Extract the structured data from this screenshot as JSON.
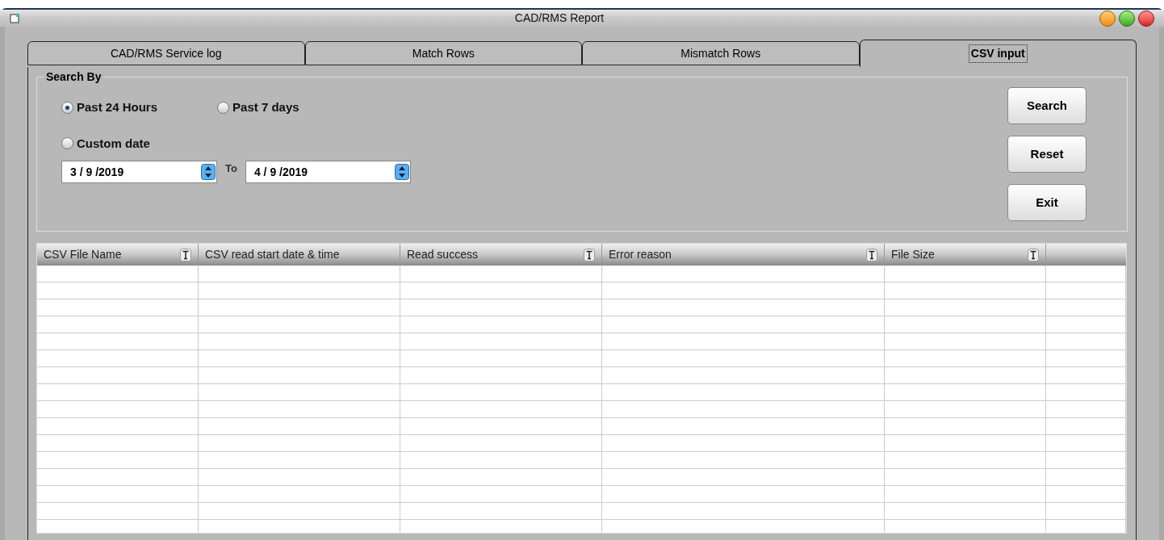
{
  "window": {
    "title": "CAD/RMS Report"
  },
  "tabs": [
    {
      "label": "CAD/RMS Service log",
      "selected": false
    },
    {
      "label": "Match Rows",
      "selected": false
    },
    {
      "label": "Mismatch Rows",
      "selected": false
    },
    {
      "label": "CSV input",
      "selected": true
    }
  ],
  "search_by": {
    "title": "Search By",
    "options": [
      {
        "label": "Past 24 Hours",
        "selected": true
      },
      {
        "label": "Past 7 days",
        "selected": false
      },
      {
        "label": "Custom date",
        "selected": false
      }
    ],
    "from_date": "3 / 9 /2019",
    "to_label": "To",
    "to_date": "4 / 9 /2019"
  },
  "buttons": [
    "Search",
    "Reset",
    "Exit"
  ],
  "table": {
    "columns": [
      {
        "label": "CSV File Name",
        "filter": true
      },
      {
        "label": "CSV read start date & time",
        "filter": false
      },
      {
        "label": "Read success",
        "filter": true
      },
      {
        "label": "Error reason",
        "filter": true
      },
      {
        "label": "File Size",
        "filter": true
      }
    ]
  }
}
